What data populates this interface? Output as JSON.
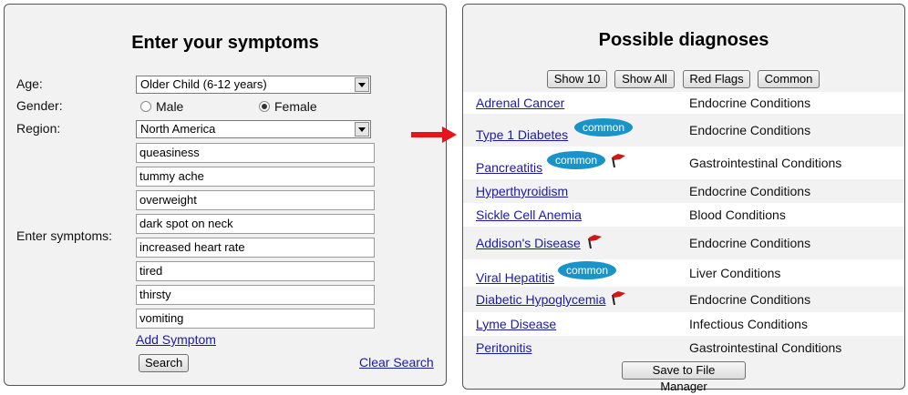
{
  "left": {
    "title": "Enter your symptoms",
    "age_label": "Age:",
    "age_value": "Older Child (6-12 years)",
    "gender_label": "Gender:",
    "gender_male": "Male",
    "gender_female": "Female",
    "gender_selected": "Female",
    "region_label": "Region:",
    "region_value": "North America",
    "symptoms_label": "Enter symptoms:",
    "symptoms": [
      "queasiness",
      "tummy ache",
      "overweight",
      "dark spot on neck",
      "increased heart rate",
      "tired",
      "thirsty",
      "vomiting"
    ],
    "add_symptom": "Add Symptom",
    "search_button": "Search",
    "clear_search": "Clear Search"
  },
  "right": {
    "title": "Possible diagnoses",
    "buttons": [
      "Show 10",
      "Show All",
      "Red Flags",
      "Common"
    ],
    "common_badge": "common",
    "diagnoses": [
      {
        "name": "Adrenal Cancer",
        "category": "Endocrine Conditions",
        "common": false,
        "red_flag": false
      },
      {
        "name": "Type 1 Diabetes",
        "category": "Endocrine Conditions",
        "common": true,
        "red_flag": false
      },
      {
        "name": "Pancreatitis",
        "category": "Gastrointestinal Conditions",
        "common": true,
        "red_flag": true
      },
      {
        "name": "Hyperthyroidism",
        "category": "Endocrine Conditions",
        "common": false,
        "red_flag": false
      },
      {
        "name": "Sickle Cell Anemia",
        "category": "Blood Conditions",
        "common": false,
        "red_flag": false
      },
      {
        "name": "Addison's Disease",
        "category": "Endocrine Conditions",
        "common": false,
        "red_flag": true
      },
      {
        "name": "Viral Hepatitis",
        "category": "Liver Conditions",
        "common": true,
        "red_flag": false
      },
      {
        "name": "Diabetic Hypoglycemia",
        "category": "Endocrine Conditions",
        "common": false,
        "red_flag": true
      },
      {
        "name": "Lyme Disease",
        "category": "Infectious Conditions",
        "common": false,
        "red_flag": false
      },
      {
        "name": "Peritonitis",
        "category": "Gastrointestinal Conditions",
        "common": false,
        "red_flag": false
      }
    ],
    "save_button": "Save to File Manager"
  },
  "colors": {
    "arrow": "#e8141b",
    "common_badge": "#1a93c9",
    "flag": "#d01818",
    "link": "#1a1aa6"
  },
  "icons": [
    "red-flag-icon",
    "arrow-right-icon",
    "dropdown-arrow-icon"
  ]
}
